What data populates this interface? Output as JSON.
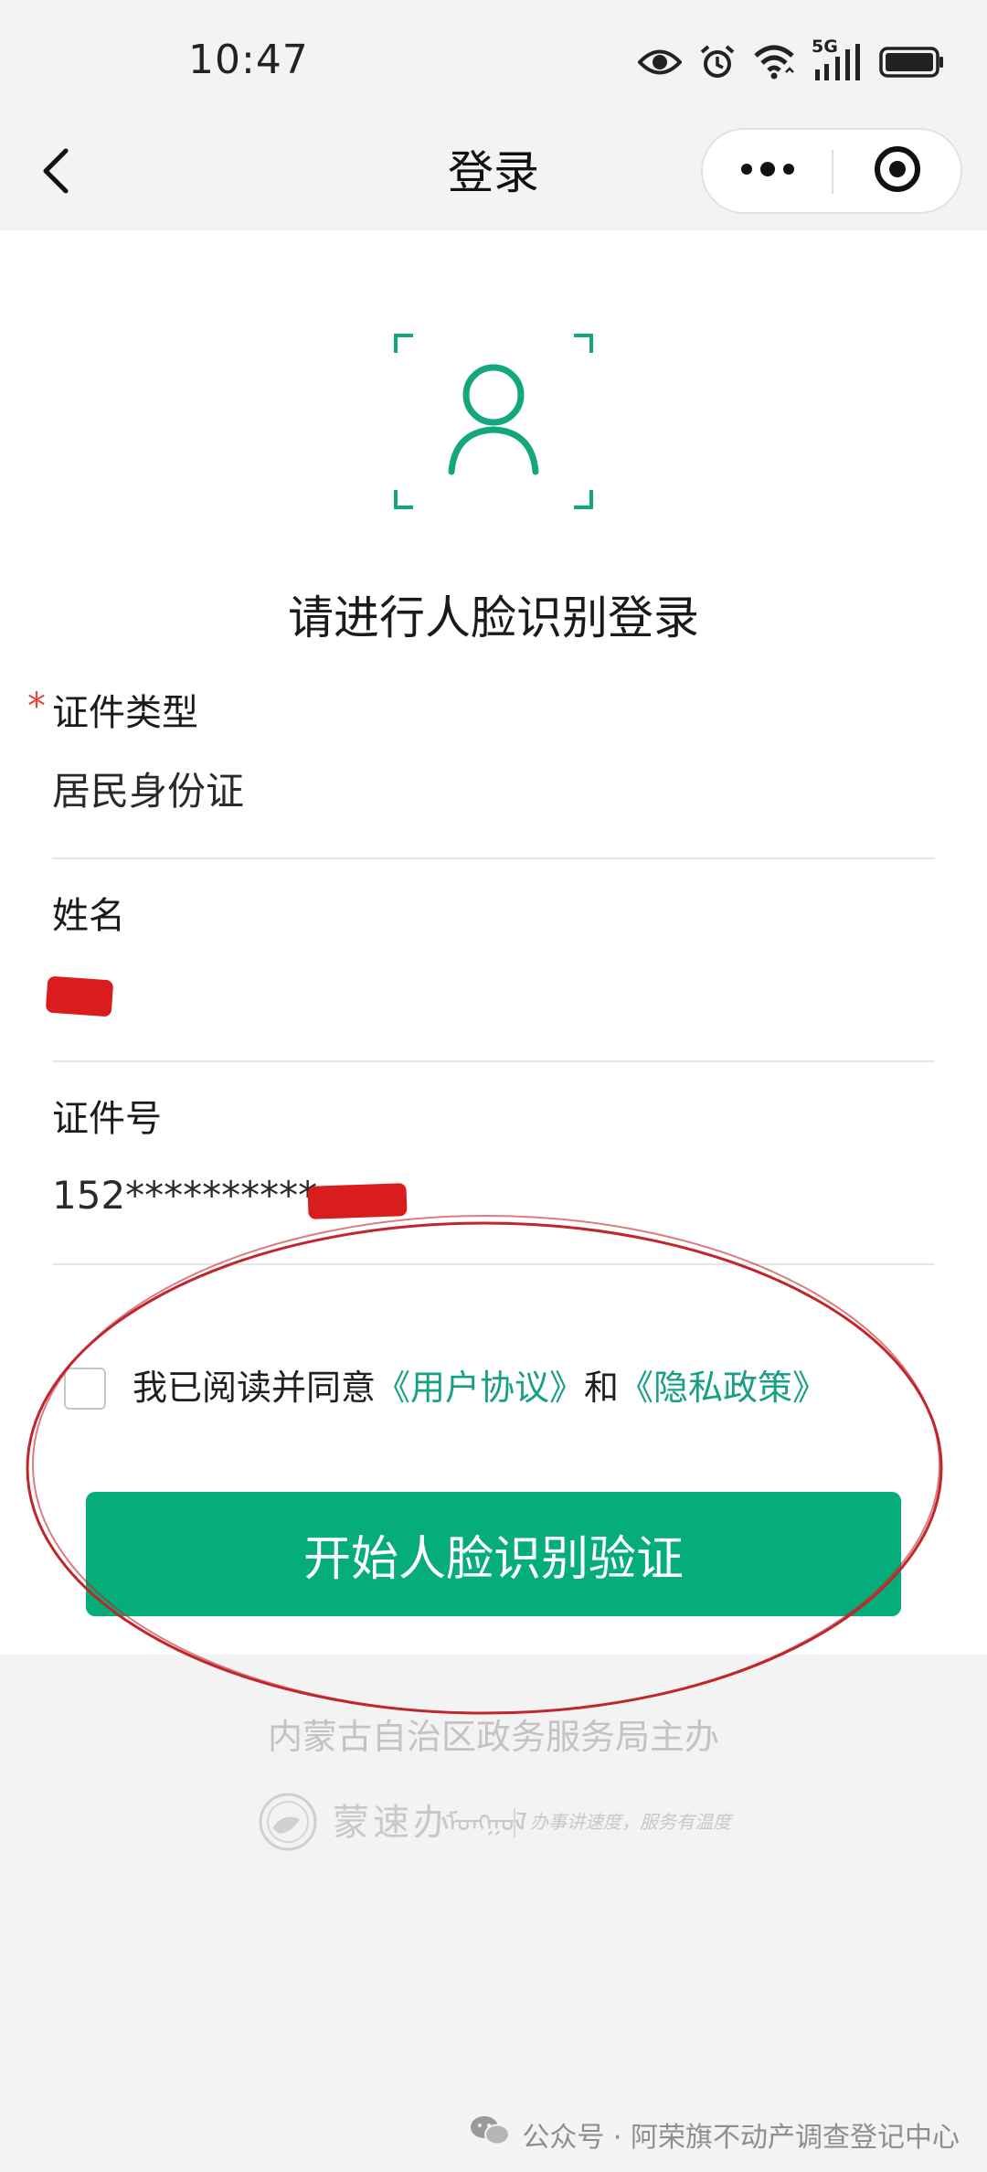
{
  "status_bar": {
    "time": "10:47",
    "network_label": "5G",
    "icons": [
      "eye-icon",
      "alarm-icon",
      "wifi-icon",
      "signal-icon",
      "battery-icon"
    ]
  },
  "nav": {
    "title": "登录",
    "back_icon": "chevron-left-icon",
    "more_icon": "more-dots-icon",
    "close_icon": "target-close-icon"
  },
  "face": {
    "icon": "face-scan-icon",
    "title": "请进行人脸识别登录"
  },
  "form": {
    "id_type": {
      "required_mark": "*",
      "label": "证件类型",
      "value": "居民身份证"
    },
    "name": {
      "label": "姓名",
      "value": ""
    },
    "id_number": {
      "label": "证件号",
      "value": "152**********"
    }
  },
  "agreement": {
    "checked": false,
    "prefix": "我已阅读并同意",
    "user_agreement": "《用户协议》",
    "conjunction": "和",
    "privacy_policy": "《隐私政策》"
  },
  "primary_button": {
    "label": "开始人脸识别验证"
  },
  "footer": {
    "host": "内蒙古自治区政务服务局主办",
    "brand": "蒙速办",
    "brand_mongolian": "ᠮᠣᠩᠭᠣᠯ",
    "slogan": "办事讲速度，服务有温度"
  },
  "watermark": {
    "text": "公众号 · 阿荣旗不动产调查登记中心",
    "icon": "wechat-icon"
  },
  "colors": {
    "accent": "#05ad7b",
    "link": "#17a085",
    "required": "#e0483c",
    "annotation": "#c0262b"
  }
}
